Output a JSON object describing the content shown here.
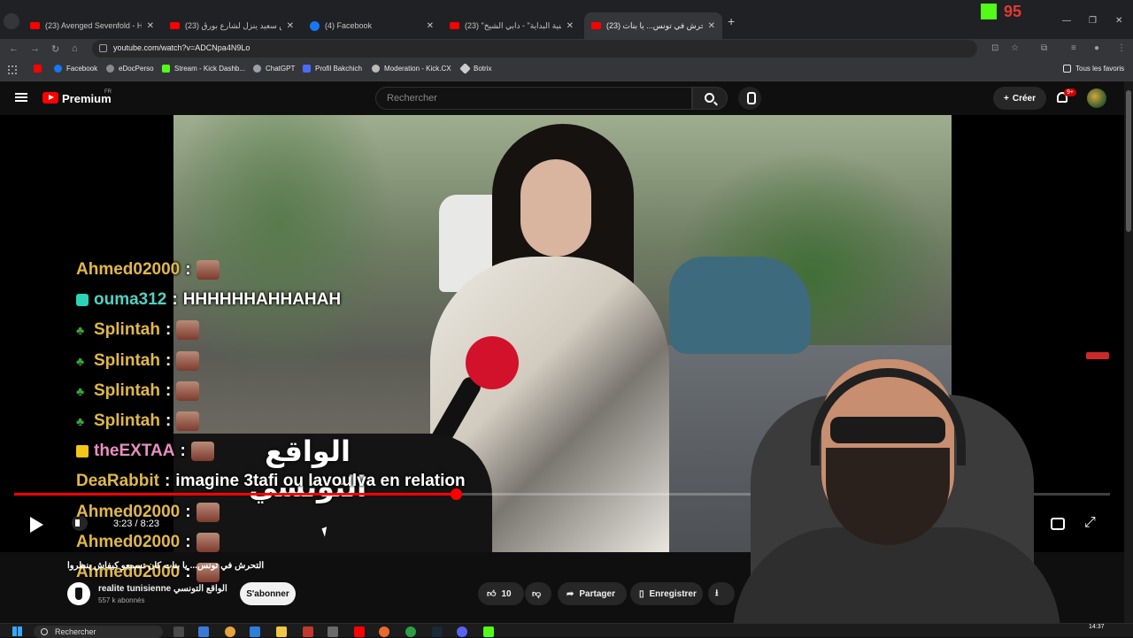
{
  "browser": {
    "tabs": [
      {
        "title": "(23) Avenged Sevenfold - Hail T",
        "favicon": "youtube-icon"
      },
      {
        "title": "(23) قيس سعيد ينزل لشارع بورڨ",
        "favicon": "youtube-icon"
      },
      {
        "title": "(4) Facebook",
        "favicon": "facebook-icon"
      },
      {
        "title": "(23) \"أغنية البداية\" - دابي الشيخ",
        "favicon": "youtube-icon"
      },
      {
        "title": "(23) التحرش في تونس... يا بنات",
        "favicon": "youtube-icon",
        "active": true
      }
    ],
    "url": "youtube.com/watch?v=ADCNpa4N9Lo",
    "kick_viewer_count": "95",
    "bookmarks": [
      "Facebook",
      "eDocPerso",
      "Stream - Kick Dashb...",
      "ChatGPT",
      "Profil Bakchich",
      "Moderation - Kick.CX",
      "Botrix"
    ],
    "all_bookmarks_label": "Tous les favoris"
  },
  "youtube": {
    "brand": "Premium",
    "region": "FR",
    "search_placeholder": "Rechercher",
    "create_label": "Créer",
    "notif_badge": "9+"
  },
  "video": {
    "watermark_line1": "الواقع",
    "watermark_line2": "التونسي",
    "time": "3:23 / 8:23",
    "progress_fraction": 0.403,
    "title": "التحرش في تونس... يا بنات كان تسمعو كيفاش ينظروا",
    "channel_name": "realite tunisienne الواقع التونسي",
    "subscribers": "557 k abonnés",
    "subscribe_label": "S'abonner",
    "likes": "10",
    "share_label": "Partager",
    "save_label": "Enregistrer"
  },
  "chat": [
    {
      "user": "Ahmed02000",
      "color": "#e0b84a",
      "badge": "",
      "text": "",
      "emote": true
    },
    {
      "user": "ouma312",
      "color": "#53d1c1",
      "badge": "sub-badge",
      "text": "HHHHHHAHHAHAH",
      "emote": false
    },
    {
      "user": "Splintah",
      "color": "#e0b84a",
      "badge": "leaf-badge",
      "text": "",
      "emote": true
    },
    {
      "user": "Splintah",
      "color": "#e0b84a",
      "badge": "leaf-badge",
      "text": "",
      "emote": true
    },
    {
      "user": "Splintah",
      "color": "#e0b84a",
      "badge": "leaf-badge",
      "text": "",
      "emote": true
    },
    {
      "user": "Splintah",
      "color": "#e0b84a",
      "badge": "leaf-badge",
      "text": "",
      "emote": true
    },
    {
      "user": "theEXTAA",
      "color": "#e88fc0",
      "badge": "crown-badge",
      "text": "",
      "emote": true
    },
    {
      "user": "DeaRabbit",
      "color": "#e0b84a",
      "badge": "",
      "text": "imagine 3tafi ou lavoulva en relation",
      "emote": false
    },
    {
      "user": "Ahmed02000",
      "color": "#e0b84a",
      "badge": "",
      "text": "",
      "emote": true
    },
    {
      "user": "Ahmed02000",
      "color": "#e0b84a",
      "badge": "",
      "text": "",
      "emote": true
    },
    {
      "user": "Ahmed02000",
      "color": "#e0b84a",
      "badge": "",
      "text": "",
      "emote": true
    }
  ],
  "taskbar": {
    "search_placeholder": "Rechercher",
    "time": "14:37"
  }
}
